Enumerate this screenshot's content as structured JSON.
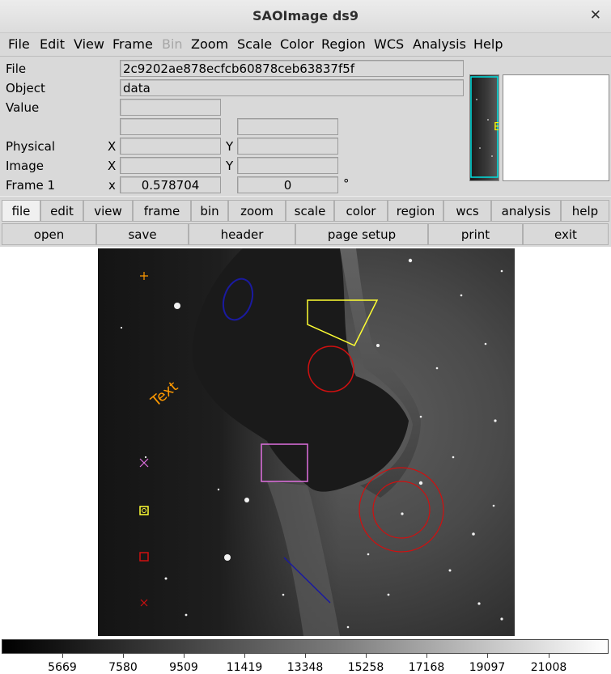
{
  "window": {
    "title": "SAOImage ds9",
    "close_glyph": "✕"
  },
  "menubar": {
    "items": [
      {
        "label": "File",
        "enabled": true
      },
      {
        "label": "Edit",
        "enabled": true
      },
      {
        "label": "View",
        "enabled": true
      },
      {
        "label": "Frame",
        "enabled": true
      },
      {
        "label": "Bin",
        "enabled": false
      },
      {
        "label": "Zoom",
        "enabled": true
      },
      {
        "label": "Scale",
        "enabled": true
      },
      {
        "label": "Color",
        "enabled": true
      },
      {
        "label": "Region",
        "enabled": true
      },
      {
        "label": "WCS",
        "enabled": true
      },
      {
        "label": "Analysis",
        "enabled": true
      },
      {
        "label": "Help",
        "enabled": true
      }
    ]
  },
  "info": {
    "file_label": "File",
    "file_value": "2c9202ae878ecfcb60878ceb63837f5f",
    "object_label": "Object",
    "object_value": "data",
    "value_label": "Value",
    "value_value": "",
    "physical_label": "Physical",
    "image_label": "Image",
    "frame_label": "Frame 1",
    "x_label": "X",
    "y_label": "Y",
    "x_lower_label": "x",
    "frame_zoom": "0.578704",
    "frame_angle": "0",
    "degree_symbol": "°"
  },
  "buttons": {
    "row1": [
      "file",
      "edit",
      "view",
      "frame",
      "bin",
      "zoom",
      "scale",
      "color",
      "region",
      "wcs",
      "analysis",
      "help"
    ],
    "row1_active": "file",
    "row2": [
      "open",
      "save",
      "header",
      "page setup",
      "print",
      "exit"
    ]
  },
  "regions": {
    "text_label": "Text",
    "colors": {
      "orange": "#ff9900",
      "blue": "#1a1aa0",
      "yellow": "#ffff33",
      "red": "#d01010",
      "magenta": "#e070e0",
      "panner_text": "#ffff00"
    }
  },
  "panner": {
    "label": "E"
  },
  "colorbar": {
    "ticks": [
      "5669",
      "7580",
      "9509",
      "11419",
      "13348",
      "15258",
      "17168",
      "19097",
      "21008"
    ]
  }
}
